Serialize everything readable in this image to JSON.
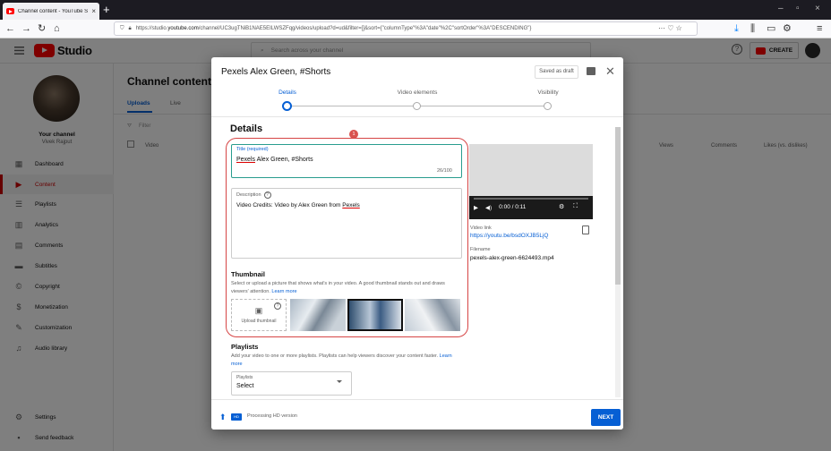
{
  "browser": {
    "tab_title": "Channel content - YouTube St...",
    "new_tab": "+",
    "url_prefix": "https://studio.",
    "url_domain": "youtube.com",
    "url_rest": "/channel/UC3ugTNiB1NAE5EILWSZFqg/videos/upload?d=ud&filter=[]&sort={\"columnType\"%3A\"date\"%2C\"sortOrder\"%3A\"DESCENDING\"}",
    "page_actions": "··· ♡ ☆"
  },
  "header": {
    "logo_text": "Studio",
    "search_placeholder": "Search across your channel",
    "create_label": "CREATE"
  },
  "sidebar": {
    "channel_name": "Your channel",
    "channel_sub": "Vivek Rajput",
    "items": [
      {
        "label": "Dashboard",
        "icon": "dashboard-icon"
      },
      {
        "label": "Content",
        "icon": "content-icon"
      },
      {
        "label": "Playlists",
        "icon": "playlists-icon"
      },
      {
        "label": "Analytics",
        "icon": "analytics-icon"
      },
      {
        "label": "Comments",
        "icon": "comments-icon"
      },
      {
        "label": "Subtitles",
        "icon": "subtitles-icon"
      },
      {
        "label": "Copyright",
        "icon": "copyright-icon"
      },
      {
        "label": "Monetization",
        "icon": "monetization-icon"
      },
      {
        "label": "Customization",
        "icon": "customization-icon"
      },
      {
        "label": "Audio library",
        "icon": "audio-library-icon"
      }
    ],
    "settings_label": "Settings",
    "feedback_label": "Send feedback"
  },
  "main": {
    "title": "Channel content",
    "tabs": [
      "Uploads",
      "Live"
    ],
    "filter_label": "Filter",
    "columns": [
      "Video",
      "Views",
      "Comments",
      "Likes (vs. dislikes)"
    ]
  },
  "dialog": {
    "title": "Pexels Alex Green, #Shorts",
    "saved_label": "Saved as draft",
    "steps": [
      "Details",
      "Video elements",
      "Visibility"
    ],
    "section_heading": "Details",
    "badge": "1",
    "title_field": {
      "label": "Title (required)",
      "value_underlined": "Pexels",
      "value_rest": " Alex Green, #Shorts",
      "count": "26/100"
    },
    "description_field": {
      "label": "Description",
      "value_main": "Video Credits: Video by Alex Green from ",
      "value_link": "Pexels"
    },
    "thumbnail": {
      "heading": "Thumbnail",
      "description": "Select or upload a picture that shows what's in your video. A good thumbnail stands out and draws viewers' attention.",
      "learn_more": "Learn more",
      "upload_label": "Upload thumbnail"
    },
    "video": {
      "time": "0:00 / 0:11",
      "link_label": "Video link",
      "link": "https://youtu.be/bsdOXJB5LjQ",
      "filename_label": "Filename",
      "filename": "pexels-alex-green-6624493.mp4"
    },
    "playlists": {
      "heading": "Playlists",
      "description": "Add your video to one or more playlists. Playlists can help viewers discover your content faster.",
      "learn_more": "Learn more",
      "select_label": "Playlists",
      "select_value": "Select"
    },
    "footer": {
      "hd_label": "HD",
      "processing": "Processing HD version",
      "next_label": "NEXT"
    }
  },
  "colors": {
    "brand_red": "#ff0000",
    "accent_blue": "#065fd4",
    "annotation_red": "#d64545"
  }
}
